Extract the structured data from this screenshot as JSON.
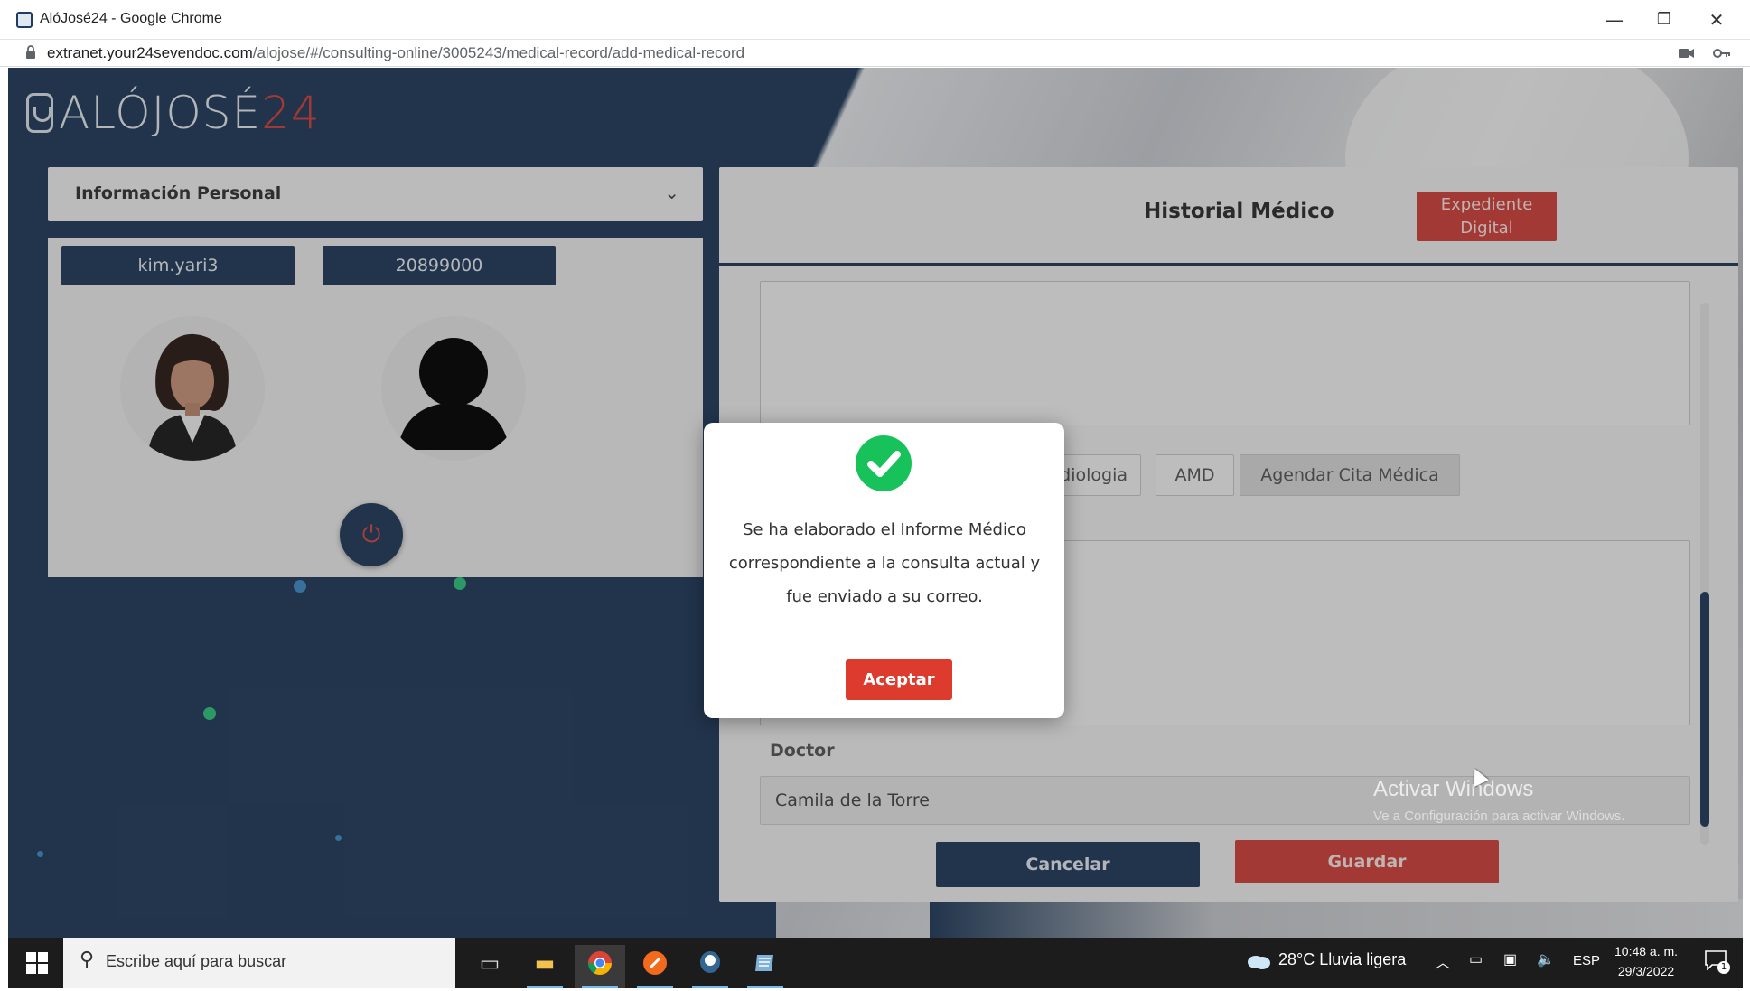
{
  "window": {
    "title": "AlóJosé24 - Google Chrome",
    "minimize": "—",
    "restore": "❐",
    "close": "✕"
  },
  "address": {
    "host": "extranet.your24sevendoc.com",
    "path": "/alojose/#/consulting-online/3005243/medical-record/add-medical-record"
  },
  "logo": {
    "text": "ALÓJOSÉ",
    "number": "24"
  },
  "sidebar": {
    "section_title": "Información Personal",
    "username": "kim.yari3",
    "id_number": "20899000",
    "power_symbol": "⏻"
  },
  "record": {
    "title": "Historial Médico",
    "digital_file_button": "Expediente Digital",
    "tabs": [
      "Laboratorios & Radiologia",
      "AMD",
      "Agendar Cita Médica"
    ],
    "tab_visible_text": [
      "torios & Radiologia",
      "AMD",
      "Agendar Cita Médica"
    ],
    "doctor_label": "Doctor",
    "doctor_value": "Camila de la Torre",
    "cancel_button": "Cancelar",
    "save_button": "Guardar"
  },
  "modal": {
    "message": "Se ha elaborado el Informe Médico correspondiente a la consulta actual y fue enviado a su correo.",
    "accept_button": "Aceptar",
    "icon": "success-check-icon"
  },
  "watermark": {
    "title": "Activar Windows",
    "subtitle": "Ve a Configuración para activar Windows."
  },
  "taskbar": {
    "search_placeholder": "Escribe aquí para buscar",
    "weather": "28°C  Lluvia ligera",
    "language": "ESP",
    "time": "10:48 a. m.",
    "date": "29/3/2022",
    "notification_count": "1"
  },
  "colors": {
    "navy": "#1f3a5a",
    "accent_red": "#d2413a",
    "success_green": "#17c25a"
  }
}
